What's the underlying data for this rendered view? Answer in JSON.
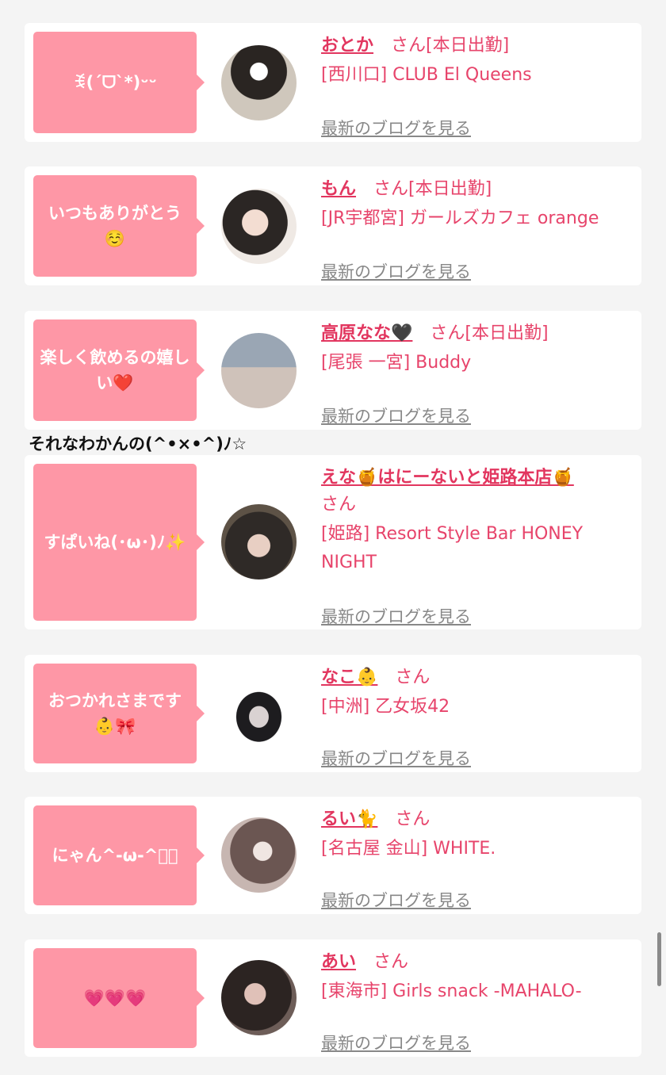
{
  "cards": [
    {
      "bubble": "ꉂ(ˊᗜˋ*)ᵕᵕ",
      "name": "おとか",
      "san": "さん",
      "badge": "[本日出勤]",
      "shop": "[西川口] CLUB El Queens",
      "blog": "最新のブログを見る"
    },
    {
      "bubble": "いつもありがとう☺️",
      "name": "もん",
      "san": "さん",
      "badge": "[本日出勤]",
      "shop": "[JR宇都宮] ガールズカフェ orange",
      "blog": "最新のブログを見る"
    },
    {
      "bubble": "楽しく飲めるの嬉しい❤️",
      "name": "高原なな🖤",
      "san": "さん",
      "badge": "[本日出勤]",
      "shop": "[尾張 一宮] Buddy",
      "blog": "最新のブログを見る"
    },
    {
      "bubble": "すぱいね(･ω･)ﾉ✨",
      "name": "えな🍯はにーないと姫路本店🍯",
      "san": "さん",
      "badge": "",
      "shop": "[姫路] Resort Style Bar HONEY NIGHT",
      "blog": "最新のブログを見る"
    },
    {
      "bubble": "おつかれさまです👶🎀",
      "name": "なこ👶",
      "san": "さん",
      "badge": "",
      "shop": "[中洲] 乙女坂42",
      "blog": "最新のブログを見る"
    },
    {
      "bubble": "にゃん^-ω-^ฅ゙",
      "name": "るい🐈",
      "san": "さん",
      "badge": "",
      "shop": "[名古屋 金山] WHITE.",
      "blog": "最新のブログを見る"
    },
    {
      "bubble": "💗💗💗",
      "name": "あい",
      "san": "さん",
      "badge": "",
      "shop": "[東海市] Girls snack -MAHALO-",
      "blog": "最新のブログを見る"
    }
  ],
  "ascii_text": "それなわかんの(^•×•^)ﾉ☆",
  "colors": {
    "accent": "#e2365f",
    "bubble": "#fe97a6",
    "link_gray": "#888888"
  }
}
